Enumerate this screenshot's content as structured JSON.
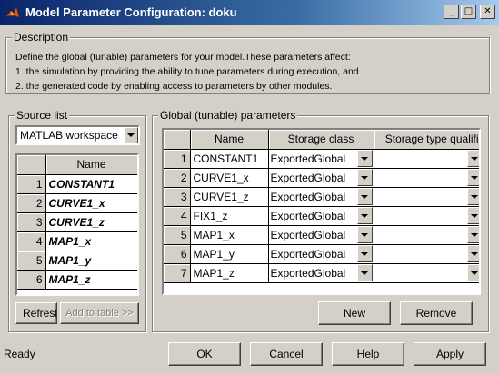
{
  "window": {
    "title": "Model Parameter Configuration: doku",
    "minimize_glyph": "_",
    "maximize_glyph": "□",
    "close_glyph": "✕"
  },
  "description": {
    "legend": "Description",
    "lines": [
      "Define the global (tunable) parameters for your model.These parameters affect:",
      "1. the simulation by providing the ability to tune parameters during execution, and",
      "2. the generated code by enabling access to parameters by other modules."
    ]
  },
  "source_list": {
    "legend": "Source list",
    "source_value": "MATLAB workspace",
    "column_header": "Name",
    "rows": [
      {
        "num": "1",
        "name": "CONSTANT1"
      },
      {
        "num": "2",
        "name": "CURVE1_x"
      },
      {
        "num": "3",
        "name": "CURVE1_z"
      },
      {
        "num": "4",
        "name": "MAP1_x"
      },
      {
        "num": "5",
        "name": "MAP1_y"
      },
      {
        "num": "6",
        "name": "MAP1_z"
      }
    ],
    "refresh_label": "Refresh",
    "add_label": "Add to table >>"
  },
  "global_params": {
    "legend": "Global (tunable) parameters",
    "headers": [
      "Name",
      "Storage class",
      "Storage type qualifier"
    ],
    "rows": [
      {
        "num": "1",
        "name": "CONSTANT1",
        "storage_class": "ExportedGlobal",
        "qualifier": ""
      },
      {
        "num": "2",
        "name": "CURVE1_x",
        "storage_class": "ExportedGlobal",
        "qualifier": ""
      },
      {
        "num": "3",
        "name": "CURVE1_z",
        "storage_class": "ExportedGlobal",
        "qualifier": ""
      },
      {
        "num": "4",
        "name": "FIX1_z",
        "storage_class": "ExportedGlobal",
        "qualifier": ""
      },
      {
        "num": "5",
        "name": "MAP1_x",
        "storage_class": "ExportedGlobal",
        "qualifier": ""
      },
      {
        "num": "6",
        "name": "MAP1_y",
        "storage_class": "ExportedGlobal",
        "qualifier": ""
      },
      {
        "num": "7",
        "name": "MAP1_z",
        "storage_class": "ExportedGlobal",
        "qualifier": ""
      }
    ],
    "new_label": "New",
    "remove_label": "Remove"
  },
  "footer": {
    "status": "Ready",
    "ok_label": "OK",
    "cancel_label": "Cancel",
    "help_label": "Help",
    "apply_label": "Apply"
  },
  "colors": {
    "titlebar_start": "#0a246a",
    "titlebar_end": "#a6caf0",
    "face": "#d4d0c8"
  }
}
